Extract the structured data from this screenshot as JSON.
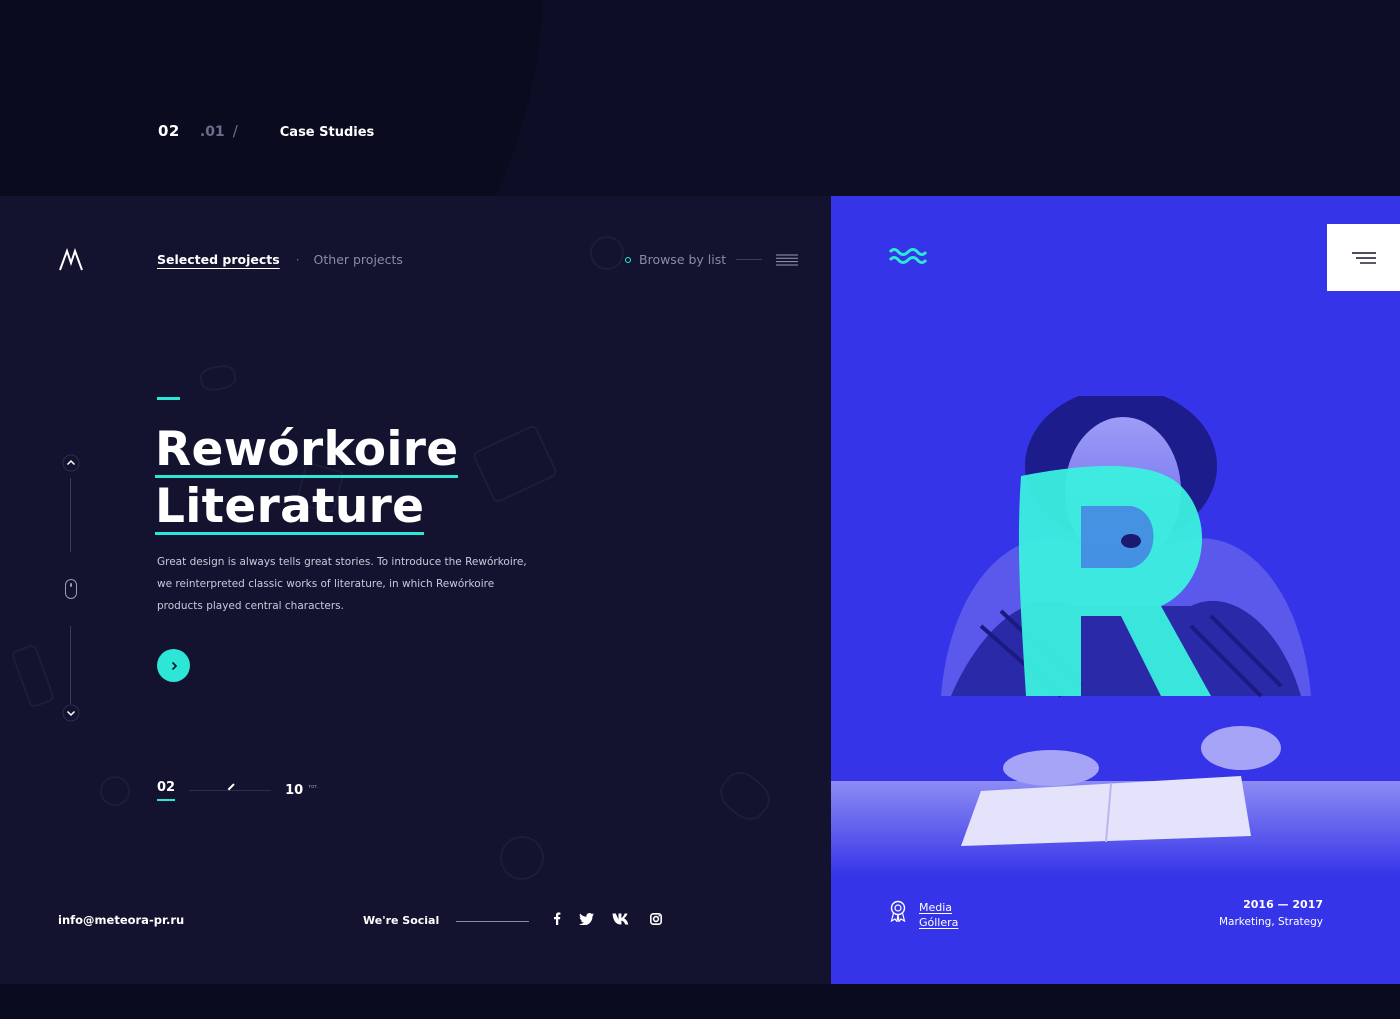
{
  "breadcrumb": {
    "section_number": "02",
    "sub_number": ".01",
    "slash": "/",
    "title": "Case Studies"
  },
  "nav": {
    "logo": "meteora-logo-icon",
    "active_tab": "Selected projects",
    "separator": "·",
    "other_tab": "Other projects",
    "browse_label": "Browse by list"
  },
  "project": {
    "title_line1": "Rewórkoire",
    "title_line2": "Literature",
    "description": "Great design is always tells great stories. To introduce the Rewórkoire, we reinterpreted classic works of literature, in which Rewórkoire products played central characters."
  },
  "counter": {
    "current": "02",
    "total": "10",
    "total_suffix": "тот."
  },
  "footer": {
    "email": "info@meteora-pr.ru",
    "social_label": "We're Social",
    "social_icons": [
      "f",
      "t",
      "vk",
      "ig"
    ]
  },
  "award": {
    "line1": "Media",
    "line2": "Góllera"
  },
  "meta": {
    "years": "2016 — 2017",
    "tags": "Marketing, Strategy"
  },
  "colors": {
    "accent": "#2ee6d6",
    "background_dark": "#13132f",
    "panel_blue": "#3534e8"
  }
}
